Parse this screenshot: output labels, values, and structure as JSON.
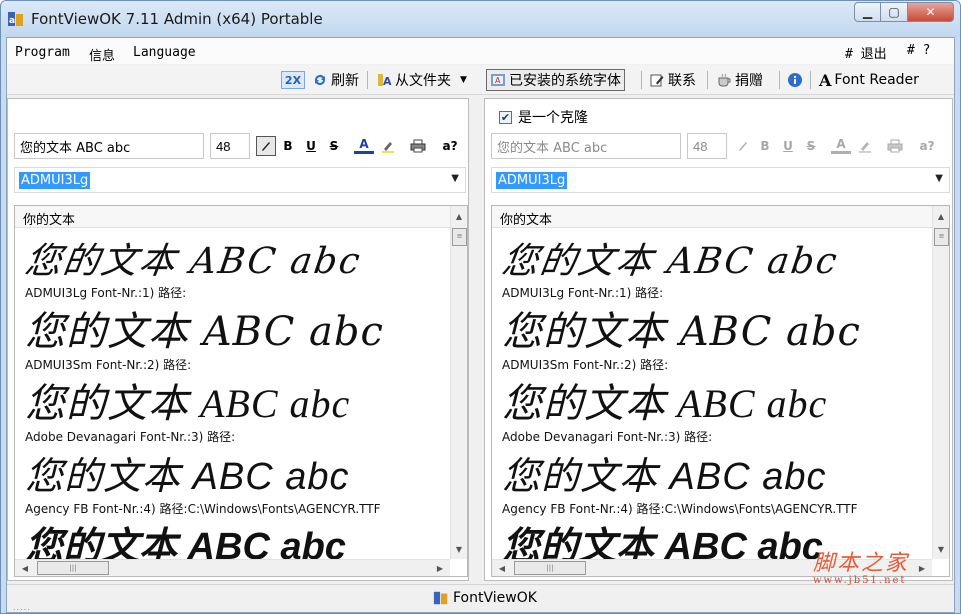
{
  "window": {
    "title": "FontViewOK 7.11 Admin (x64) Portable",
    "controls": {
      "minimize": "▁",
      "maximize": "▢",
      "close": "✕"
    }
  },
  "menu": {
    "items": [
      "Program",
      "信息",
      "Language"
    ],
    "right": [
      "# 退出",
      "# ?"
    ]
  },
  "toolbar": {
    "zoom_label": "2X",
    "refresh_label": "刷新",
    "from_folder_label": "从文件夹",
    "installed_fonts_label": "已安装的系统字体",
    "contact_label": "联系",
    "donate_label": "捐赠",
    "font_reader_label": "Font Reader"
  },
  "left_panel": {
    "text_value": "您的文本 ABC abc",
    "size_value": "48",
    "selected_font": "ADMUI3Lg",
    "list_header": "你的文本",
    "samples": [
      {
        "text": "您的文本 ABC abc",
        "caption": "ADMUI3Lg Font-Nr.:1) 路径:"
      },
      {
        "text": "您的文本 ABC abc",
        "caption": "ADMUI3Sm Font-Nr.:2) 路径:"
      },
      {
        "text": "您的文本 ABC abc",
        "caption": "Adobe Devanagari Font-Nr.:3) 路径:"
      },
      {
        "text": "您的文本 ABC abc",
        "caption": "Agency FB Font-Nr.:4) 路径:C:\\Windows\\Fonts\\AGENCYR.TTF"
      },
      {
        "text": "您的文本 ABC abc",
        "caption": ""
      }
    ]
  },
  "right_panel": {
    "clone_label": "是一个克隆",
    "clone_checked": true,
    "text_value": "您的文本 ABC abc",
    "size_value": "48",
    "selected_font": "ADMUI3Lg",
    "list_header": "你的文本",
    "samples": [
      {
        "text": "您的文本 ABC abc",
        "caption": "ADMUI3Lg Font-Nr.:1) 路径:"
      },
      {
        "text": "您的文本 ABC abc",
        "caption": "ADMUI3Sm Font-Nr.:2) 路径:"
      },
      {
        "text": "您的文本 ABC abc",
        "caption": "Adobe Devanagari Font-Nr.:3) 路径:"
      },
      {
        "text": "您的文本 ABC abc",
        "caption": "Agency FB Font-Nr.:4) 路径:C:\\Windows\\Fonts\\AGENCYR.TTF"
      },
      {
        "text": "您的文本 ABC abc",
        "caption": ""
      }
    ]
  },
  "format_buttons": {
    "bold": "B",
    "underline": "U",
    "strike": "S",
    "color": "A",
    "help": "a?"
  },
  "statusbar": {
    "app_name": "FontViewOK",
    "grip": "....."
  },
  "watermark": {
    "line1": "脚本之家",
    "line2": "www.jb51.net"
  },
  "colors": {
    "selection": "#3399ff",
    "title_bg": "#c9dcef",
    "close_button": "#c74a38",
    "watermark": "#e45d3a"
  }
}
